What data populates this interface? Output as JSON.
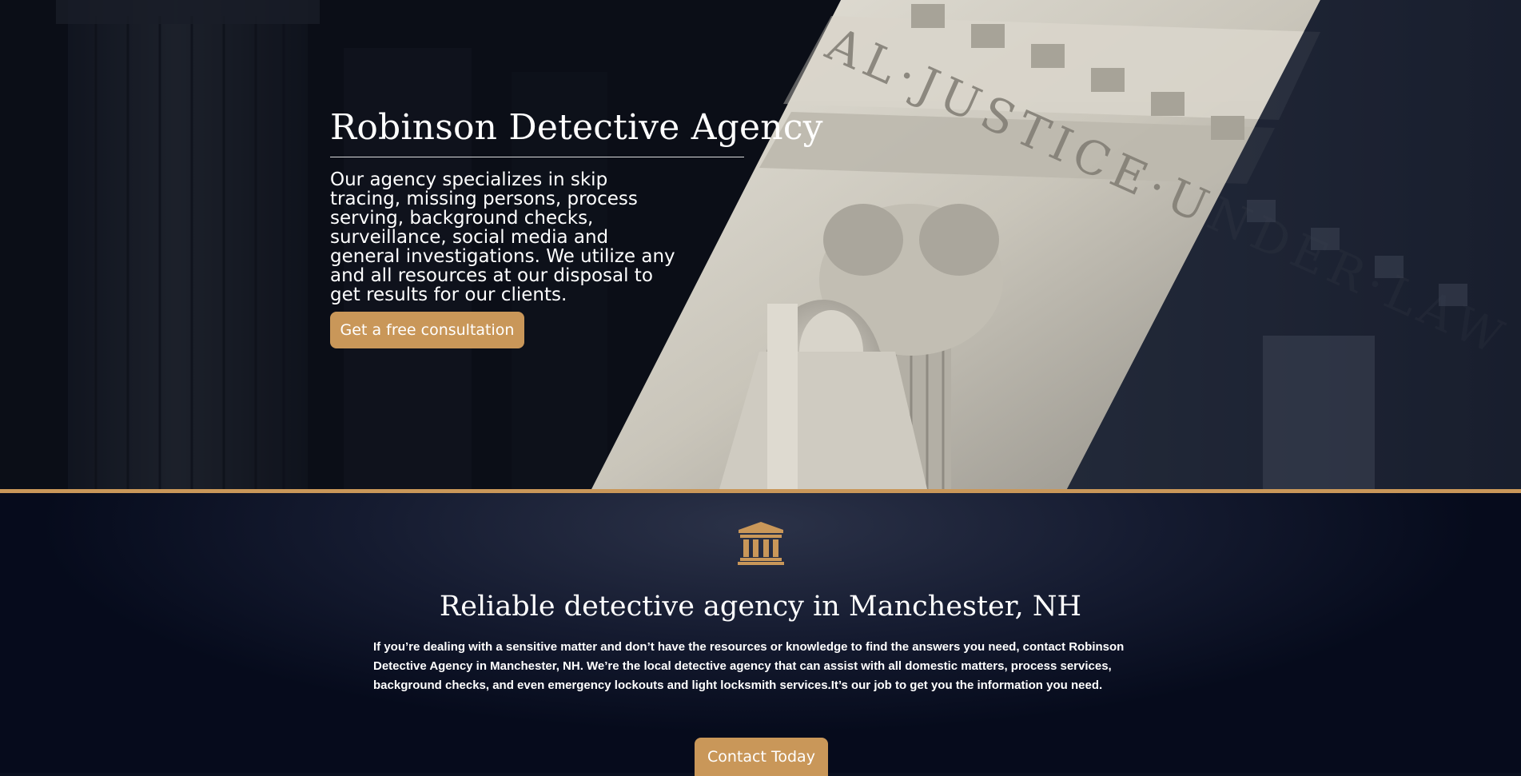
{
  "hero": {
    "title": "Robinson Detective Agency",
    "description": "Our agency specializes in skip tracing, missing persons, process serving, background checks, surveillance, social media and general investigations. We utilize any and all resources at our disposal to get results for our clients.",
    "cta_label": "Get a free consultation",
    "background_image": "supreme-court-facade",
    "engraving_text": "EQUAL JUSTICE UNDER LAW"
  },
  "about": {
    "icon": "courthouse-icon",
    "title": "Reliable detective agency in Manchester, NH",
    "body": "If you’re dealing with a sensitive matter and don’t have the resources or knowledge to find the answers you need, contact Robinson Detective Agency in Manchester, NH. We’re the local detective agency that can assist with all domestic matters, process services, background checks, and even emergency lockouts and light locksmith services.It’s our job to get you the information you need.",
    "cta_label": "Contact Today"
  },
  "colors": {
    "accent": "#c99759",
    "dark_navy": "#0a1020",
    "text": "#ffffff"
  }
}
